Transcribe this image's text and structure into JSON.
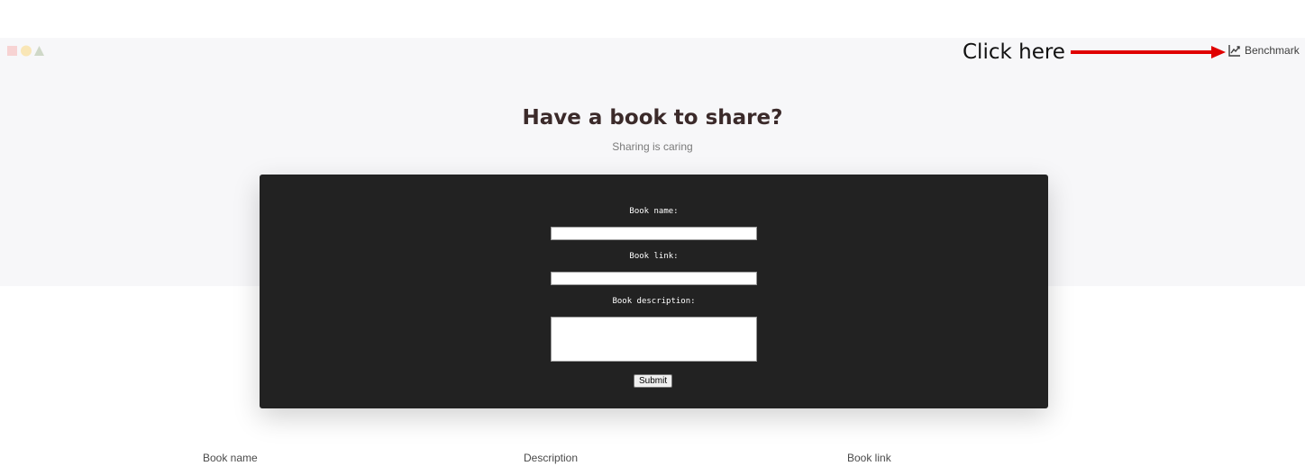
{
  "annotation": {
    "text": "Click here"
  },
  "nav": {
    "benchmark_label": "Benchmark"
  },
  "hero": {
    "title": "Have a book to share?",
    "subtitle": "Sharing is caring"
  },
  "form": {
    "book_name_label": "Book name:",
    "book_name_value": "",
    "book_link_label": "Book link:",
    "book_link_value": "",
    "book_description_label": "Book description:",
    "book_description_value": "",
    "submit_label": "Submit"
  },
  "table": {
    "columns": [
      "Book name",
      "Description",
      "Book link"
    ]
  },
  "colors": {
    "hero_background": "#f7f7f9",
    "form_background": "#222222",
    "annotation_arrow": "#e00000",
    "title_text": "#3b2a2a"
  },
  "icons": {
    "logo": "logo-shapes-icon",
    "benchmark": "line-chart-icon",
    "annotation": "arrow-right-icon"
  }
}
